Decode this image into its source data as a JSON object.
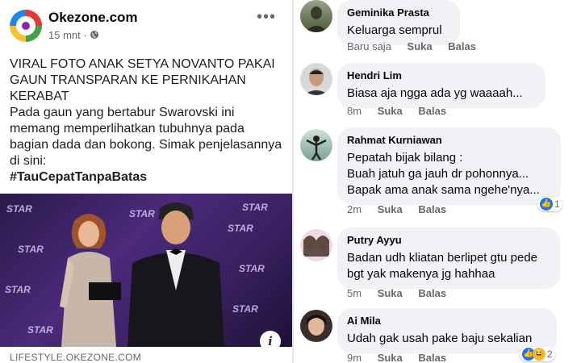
{
  "post": {
    "page_name": "Okezone.com",
    "time": "15 mnt",
    "privacy_dot": "·",
    "headline": "VIRAL FOTO ANAK SETYA NOVANTO PAKAI GAUN TRANSPARAN KE PERNIKAHAN KERABAT",
    "body": "Pada gaun yang bertabur Swarovski ini memang memperlihatkan tubuhnya pada bagian dada dan bokong. Simak penjelasannya di sini:",
    "hashtag": "#TauCepatTanpaBatas",
    "link_source": "LIFESTYLE.OKEZONE.COM",
    "more_icon": "more-horizontal-icon",
    "info_label": "i"
  },
  "photo_backdrop": [
    "STAR",
    "STAR",
    "STAR",
    "STAR",
    "STAR",
    "STAR",
    "STAR",
    "STAR",
    "STAR"
  ],
  "comments": [
    {
      "name": "Geminika Prasta",
      "lines": [
        "Keluarga semprul"
      ],
      "time": "Baru saja",
      "like": "Suka",
      "reply": "Balas"
    },
    {
      "name": "Hendri Lim",
      "lines": [
        "Biasa aja ngga ada yg waaaah..."
      ],
      "time": "8m",
      "like": "Suka",
      "reply": "Balas"
    },
    {
      "name": "Rahmat Kurniawan",
      "lines": [
        "Pepatah bijak bilang :",
        "Buah jatuh ga jauh dr pohonnya...",
        "Bapak ama anak sama ngehe'nya..."
      ],
      "time": "2m",
      "like": "Suka",
      "reply": "Balas",
      "reaction_count": "1"
    },
    {
      "name": "Putry Ayyu",
      "lines": [
        "Badan udh kliatan berlipet gtu pede",
        "bgt yak makenya jg hahhaa"
      ],
      "time": "5m",
      "like": "Suka",
      "reply": "Balas"
    },
    {
      "name": "Ai Mila",
      "lines": [
        "Udah gak usah pake baju sekalian"
      ],
      "time": "9m",
      "like": "Suka",
      "reply": "Balas",
      "reaction_count": "2"
    }
  ],
  "colors": {
    "bubble": "#f0f2f5",
    "like_blue": "#1877f2",
    "haha_yellow": "#f7b928",
    "meta_gray": "#65676b"
  }
}
